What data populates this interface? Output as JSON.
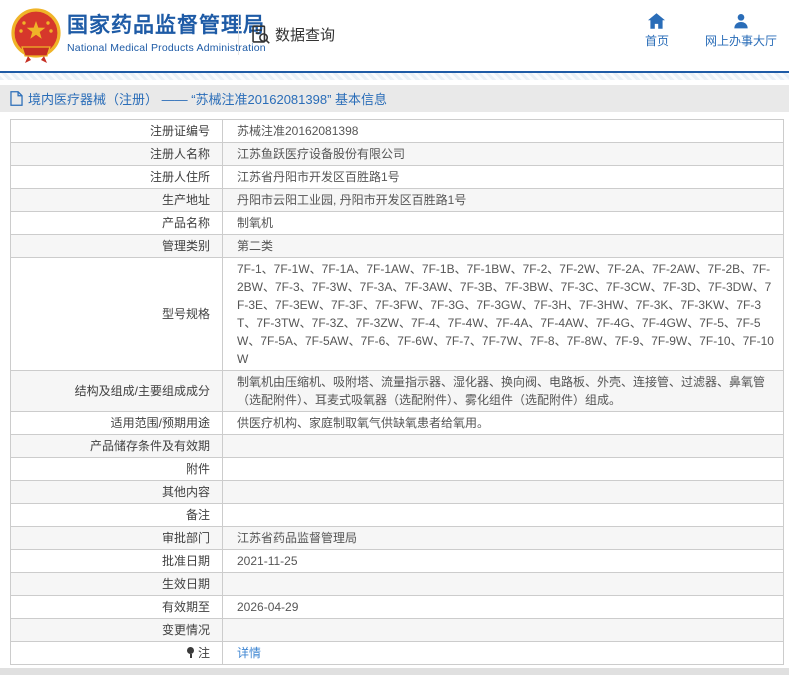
{
  "colors": {
    "accent_blue": "#1e5ba6",
    "nav_blue": "#2a6db8",
    "link_blue": "#3d85d2",
    "emblem_red": "#d6372b",
    "emblem_gold": "#f0b428",
    "breadcrumb_bg": "#e9e9e9",
    "row_alt_bg": "#f6f6f6"
  },
  "header": {
    "title": "国家药品监督管理局",
    "subtitle": "National Medical Products Administration",
    "data_query_label": "数据查询",
    "nav": {
      "home": "首页",
      "hall": "网上办事大厅"
    }
  },
  "breadcrumb": {
    "text": "境内医疗器械（注册） —— “苏械注准20162081398” 基本信息"
  },
  "table": {
    "rows": [
      {
        "label": "注册证编号",
        "value": "苏械注准20162081398"
      },
      {
        "label": "注册人名称",
        "value": "江苏鱼跃医疗设备股份有限公司"
      },
      {
        "label": "注册人住所",
        "value": "江苏省丹阳市开发区百胜路1号"
      },
      {
        "label": "生产地址",
        "value": "丹阳市云阳工业园, 丹阳市开发区百胜路1号"
      },
      {
        "label": "产品名称",
        "value": "制氧机"
      },
      {
        "label": "管理类别",
        "value": "第二类"
      },
      {
        "label": "型号规格",
        "value": "7F-1、7F-1W、7F-1A、7F-1AW、7F-1B、7F-1BW、7F-2、7F-2W、7F-2A、7F-2AW、7F-2B、7F-2BW、7F-3、7F-3W、7F-3A、7F-3AW、7F-3B、7F-3BW、7F-3C、7F-3CW、7F-3D、7F-3DW、7F-3E、7F-3EW、7F-3F、7F-3FW、7F-3G、7F-3GW、7F-3H、7F-3HW、7F-3K、7F-3KW、7F-3T、7F-3TW、7F-3Z、7F-3ZW、7F-4、7F-4W、7F-4A、7F-4AW、7F-4G、7F-4GW、7F-5、7F-5W、7F-5A、7F-5AW、7F-6、7F-6W、7F-7、7F-7W、7F-8、7F-8W、7F-9、7F-9W、7F-10、7F-10W"
      },
      {
        "label": "结构及组成/主要组成成分",
        "value": "制氧机由压缩机、吸附塔、流量指示器、湿化器、换向阀、电路板、外壳、连接管、过滤器、鼻氧管（选配附件）、耳麦式吸氧器（选配附件）、雾化组件（选配附件）组成。"
      },
      {
        "label": "适用范围/预期用途",
        "value": "供医疗机构、家庭制取氧气供缺氧患者给氧用。"
      },
      {
        "label": "产品储存条件及有效期",
        "value": ""
      },
      {
        "label": "附件",
        "value": ""
      },
      {
        "label": "其他内容",
        "value": ""
      },
      {
        "label": "备注",
        "value": ""
      },
      {
        "label": "审批部门",
        "value": "江苏省药品监督管理局"
      },
      {
        "label": "批准日期",
        "value": "2021-11-25"
      },
      {
        "label": "生效日期",
        "value": ""
      },
      {
        "label": "有效期至",
        "value": "2026-04-29"
      },
      {
        "label": "变更情况",
        "value": ""
      },
      {
        "label": "注",
        "value": "详情",
        "icon": "note-icon",
        "link": true
      }
    ]
  }
}
